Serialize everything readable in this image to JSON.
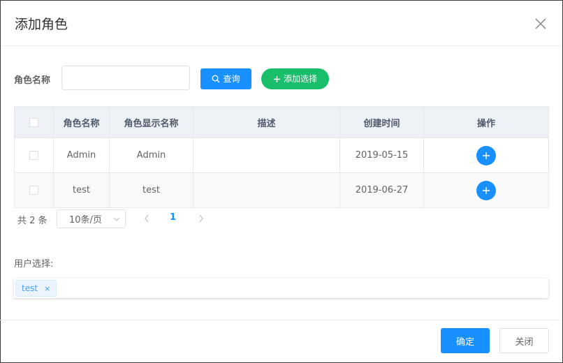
{
  "dialog": {
    "title": "添加角色"
  },
  "query": {
    "role_name_label": "角色名称",
    "role_name_value": "",
    "search_label": "查询",
    "add_selection_label": "添加选择"
  },
  "table": {
    "headers": [
      "",
      "角色名称",
      "角色显示名称",
      "描述",
      "创建时间",
      "操作"
    ],
    "rows": [
      {
        "role_name": "Admin",
        "display_name": "Admin",
        "description": "",
        "created": "2019-05-15"
      },
      {
        "role_name": "test",
        "display_name": "test",
        "description": "",
        "created": "2019-06-27"
      }
    ]
  },
  "pagination": {
    "total": "共 2 条",
    "page_size": "10条/页",
    "current_page": "1"
  },
  "user_select": {
    "label": "用户选择:",
    "tags": [
      "test"
    ],
    "tag_close": "×"
  },
  "footer": {
    "confirm_label": "确定",
    "close_label": "关闭"
  },
  "colors": {
    "primary": "#1890ff",
    "success": "#19be6b"
  }
}
